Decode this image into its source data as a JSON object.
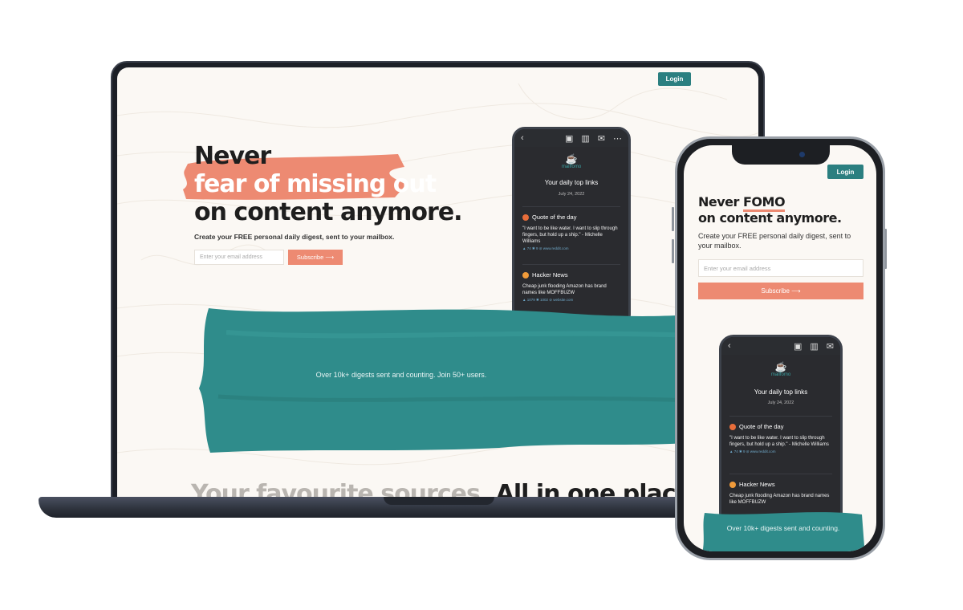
{
  "login_label": "Login",
  "hero": {
    "line1": "Never",
    "line2": "fear of missing out",
    "line3": "on content anymore.",
    "mobile_line1_a": "Never",
    "mobile_line1_b": "FOMO",
    "mobile_line2": "on content anymore.",
    "subtitle": "Create your FREE personal daily digest, sent to your mailbox."
  },
  "form": {
    "email_placeholder": "Enter your email address",
    "subscribe_label": "Subscribe ⟶"
  },
  "email_preview": {
    "brand": "mailfomo",
    "heading": "Your daily top links",
    "date": "July 24, 2022",
    "quote_section": "Quote of the day",
    "quote_text": "\"I want to be like water. I want to slip through fingers, but hold up a ship.\" - Michelle Williams",
    "quote_meta": "▲ 74 ✱ 9 ⊘ www.reddit.com",
    "hn_section": "Hacker News",
    "hn_text": "Cheap junk flooding Amazon has brand names like MOFFBUZW",
    "hn_meta": "▲ 1079 ✱ 1002 ⊘ website.com"
  },
  "counter_text": "Over 10k+ digests sent and counting. Join 50+ users.",
  "counter_text_mobile": "Over 10k+ digests sent and counting.",
  "section_heading": {
    "muted": "Your favourite sources.",
    "strong": "All in one place."
  },
  "colors": {
    "teal": "#2b7f80",
    "coral": "#ed8a72",
    "background": "#fbf8f4",
    "brush_teal": "#2f8c8b"
  }
}
